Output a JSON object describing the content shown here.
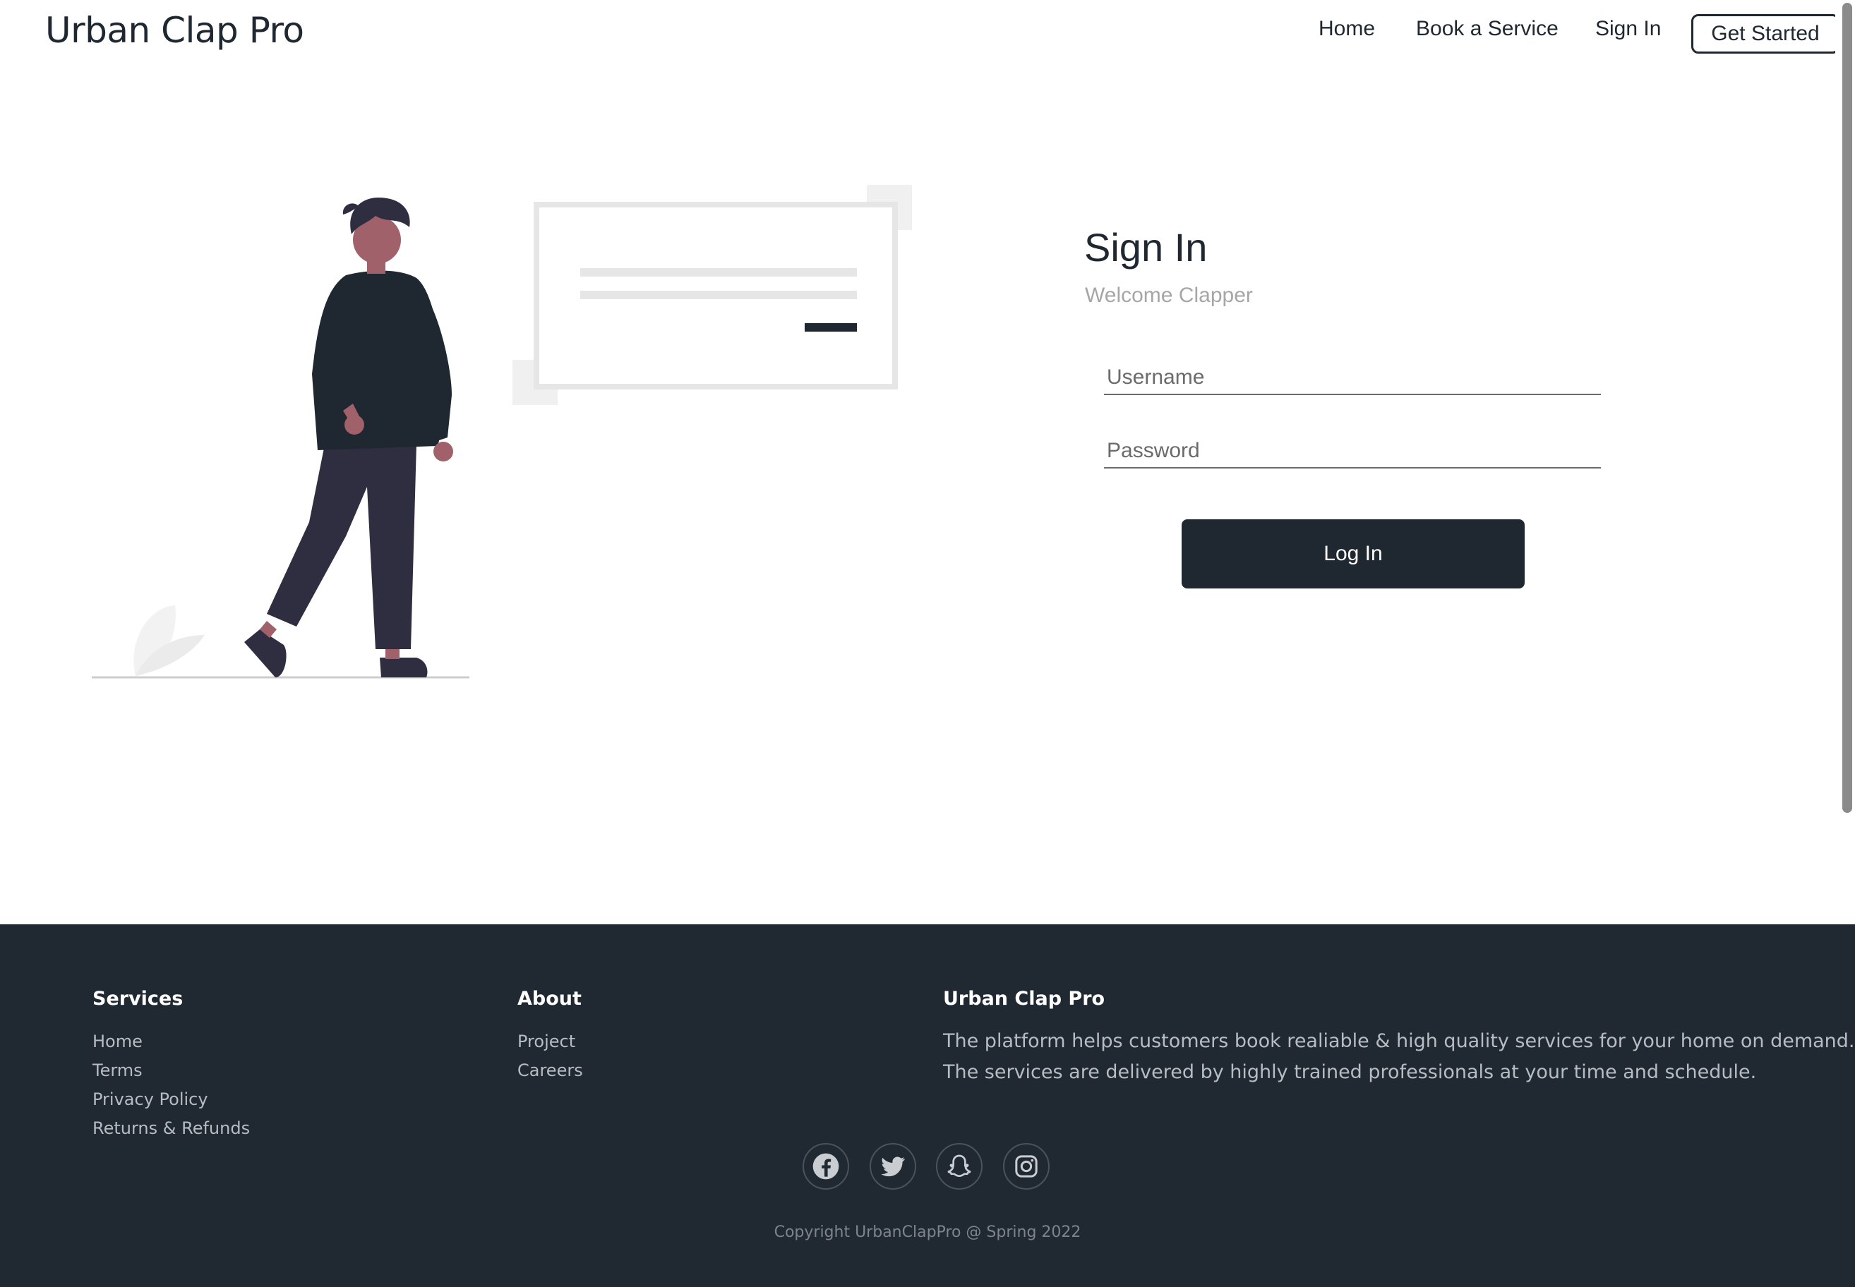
{
  "header": {
    "brand": "Urban Clap Pro",
    "nav": [
      "Home",
      "Book a Service",
      "Sign In"
    ],
    "cta": "Get Started"
  },
  "signin": {
    "title": "Sign In",
    "subtitle": "Welcome Clapper",
    "username_placeholder": "Username",
    "password_placeholder": "Password",
    "username_value": "",
    "password_value": "",
    "login_label": "Log In"
  },
  "footer": {
    "services": {
      "heading": "Services",
      "links": [
        "Home",
        "Terms",
        "Privacy Policy",
        "Returns & Refunds"
      ]
    },
    "about": {
      "heading": "About",
      "links": [
        "Project",
        "Careers"
      ]
    },
    "brand": {
      "heading": "Urban Clap Pro",
      "lines": [
        "The platform helps customers book realiable & high quality services for your home on demand.",
        "The services are delivered by highly trained professionals at your time and schedule."
      ]
    },
    "social_icons": [
      "facebook-icon",
      "twitter-icon",
      "snapchat-icon",
      "instagram-icon"
    ],
    "copyright": "Copyright UrbanClapPro @ Spring 2022"
  },
  "colors": {
    "primary_dark": "#1f2731",
    "footer_bg": "#202831",
    "muted_text": "#a6a6a6"
  }
}
